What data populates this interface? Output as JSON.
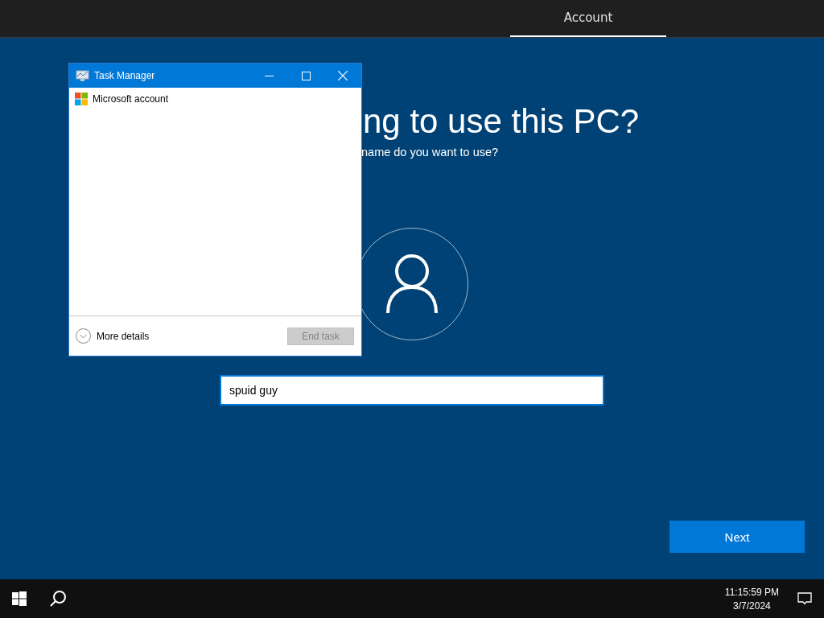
{
  "top_bar": {
    "tabs": [
      {
        "label": "Account",
        "selected": true
      }
    ]
  },
  "page": {
    "heading": "ng to use this PC?",
    "subheading": "name do you want to use?",
    "name_field": {
      "value": "spuid guy"
    },
    "next_button": "Next"
  },
  "task_manager": {
    "title": "Task Manager",
    "apps": [
      "Microsoft account"
    ],
    "more_details": "More details",
    "end_task": {
      "label": "End task",
      "disabled": true
    }
  },
  "taskbar": {
    "time": "11:15:59 PM",
    "date": "3/7/2024"
  }
}
